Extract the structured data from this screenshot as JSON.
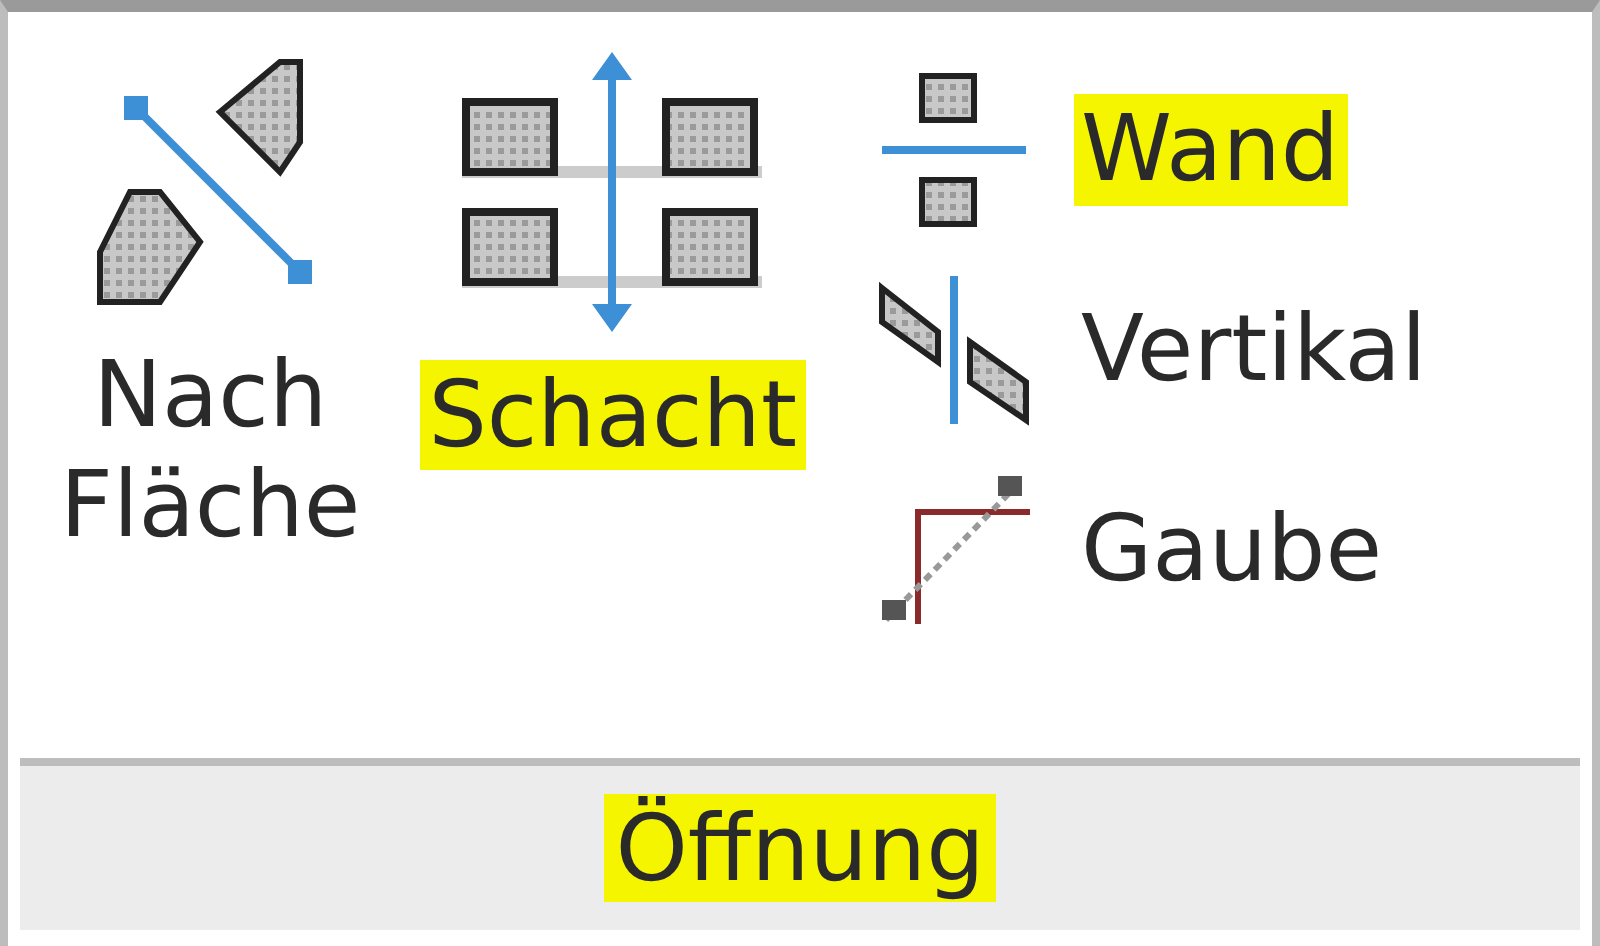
{
  "panel": {
    "title": "Öffnung",
    "title_highlighted": true,
    "large_buttons": [
      {
        "kind": "area",
        "label": "Nach\nFläche",
        "highlighted": false
      },
      {
        "kind": "shaft",
        "label": "Schacht",
        "highlighted": true
      }
    ],
    "small_buttons": [
      {
        "kind": "wall",
        "label": "Wand",
        "highlighted": true
      },
      {
        "kind": "vertical",
        "label": "Vertikal",
        "highlighted": false
      },
      {
        "kind": "dormer",
        "label": "Gaube",
        "highlighted": false
      }
    ]
  }
}
